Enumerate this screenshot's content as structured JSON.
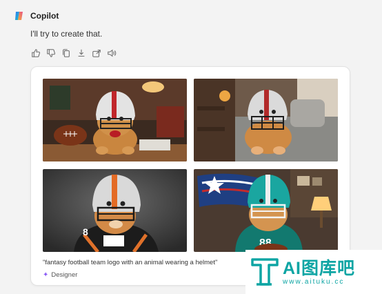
{
  "app": {
    "title": "Copilot"
  },
  "message": {
    "text": "I'll try to create that."
  },
  "actions": [
    {
      "name": "like-icon"
    },
    {
      "name": "dislike-icon"
    },
    {
      "name": "copy-icon"
    },
    {
      "name": "download-icon"
    },
    {
      "name": "share-icon"
    },
    {
      "name": "read-aloud-icon"
    }
  ],
  "card": {
    "caption": "\"fantasy football team logo with an animal wearing a helmet\"",
    "source_label": "Designer",
    "images": [
      {
        "name": "generated-image-1",
        "theme": "cat-red-helmet-football"
      },
      {
        "name": "generated-image-2",
        "theme": "cat-helmet-couch"
      },
      {
        "name": "generated-image-3",
        "theme": "cat-orange-helmet-jersey"
      },
      {
        "name": "generated-image-4",
        "theme": "cat-teal-jersey-flag"
      }
    ]
  },
  "watermark": {
    "title": "AI图库吧",
    "url": "www.aituku.cc"
  },
  "colors": {
    "accent": "#0ea5a4",
    "background": "#f3f3f3"
  }
}
